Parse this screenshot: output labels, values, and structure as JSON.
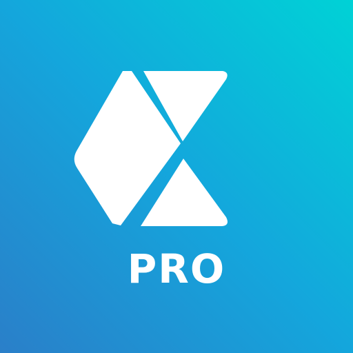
{
  "app_icon": {
    "logo_icon": "x-mark-logo-icon",
    "label": "PRO",
    "colors": {
      "gradient_top_right": "#00d2d6",
      "gradient_middle": "#14a6dc",
      "gradient_bottom_left": "#2a7fc9",
      "foreground": "#ffffff"
    }
  }
}
